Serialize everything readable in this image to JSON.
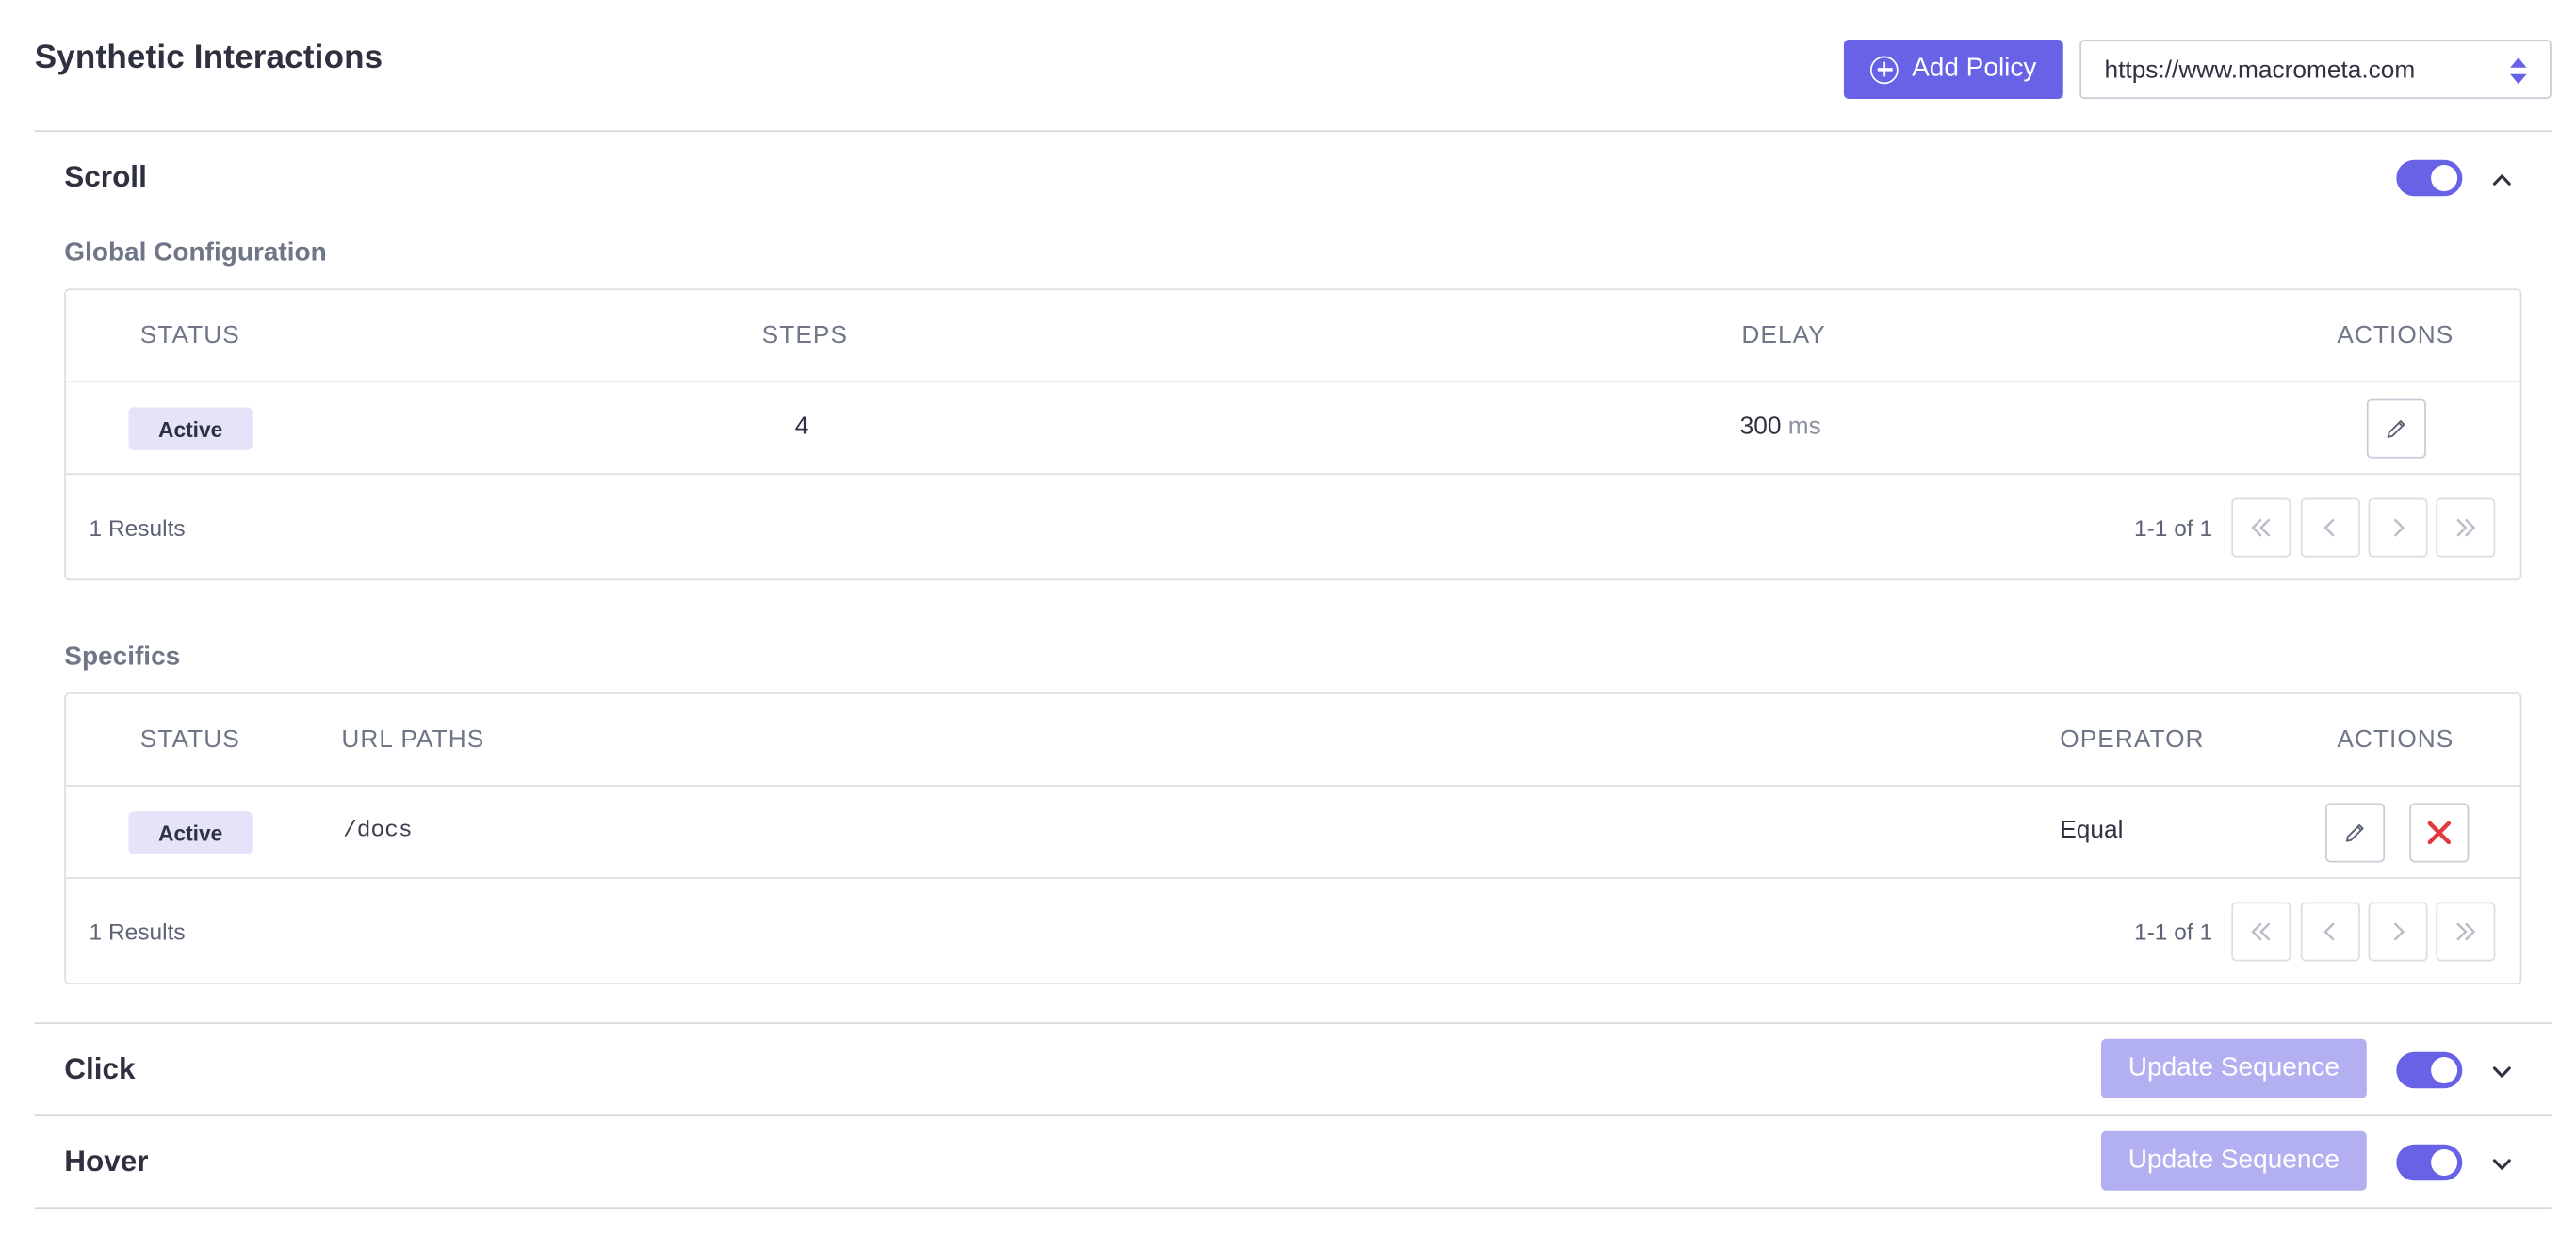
{
  "header": {
    "title": "Synthetic Interactions",
    "add_policy_label": "Add Policy",
    "url_selected": "https://www.macrometa.com"
  },
  "colors": {
    "accent": "#6762e6",
    "accent_disabled": "#b3b0f2",
    "badge_bg": "#e4e3fa",
    "danger": "#e0393e"
  },
  "sections": {
    "scroll": {
      "title": "Scroll",
      "enabled": true,
      "expanded": true,
      "global": {
        "title": "Global Configuration",
        "columns": [
          "STATUS",
          "STEPS",
          "DELAY",
          "ACTIONS"
        ],
        "row": {
          "status": "Active",
          "steps": "4",
          "delay": "300",
          "delay_unit": "ms"
        },
        "results": "1 Results",
        "range": "1-1 of 1"
      },
      "specifics": {
        "title": "Specifics",
        "columns": [
          "STATUS",
          "URL PATHS",
          "OPERATOR",
          "ACTIONS"
        ],
        "row": {
          "status": "Active",
          "url_path": "/docs",
          "operator": "Equal"
        },
        "results": "1 Results",
        "range": "1-1 of 1"
      }
    },
    "click": {
      "title": "Click",
      "enabled": true,
      "expanded": false,
      "update_label": "Update Sequence"
    },
    "hover": {
      "title": "Hover",
      "enabled": true,
      "expanded": false,
      "update_label": "Update Sequence"
    }
  },
  "icons": {
    "add_policy": "plus-circle-icon",
    "url_select": "sort-arrows-icon",
    "edit": "pencil-icon",
    "delete": "close-icon",
    "collapse": "chevron-up-icon",
    "expand": "chevron-down-icon",
    "first_page": "double-chevron-left-icon",
    "prev_page": "chevron-left-icon",
    "next_page": "chevron-right-icon",
    "last_page": "double-chevron-right-icon"
  }
}
